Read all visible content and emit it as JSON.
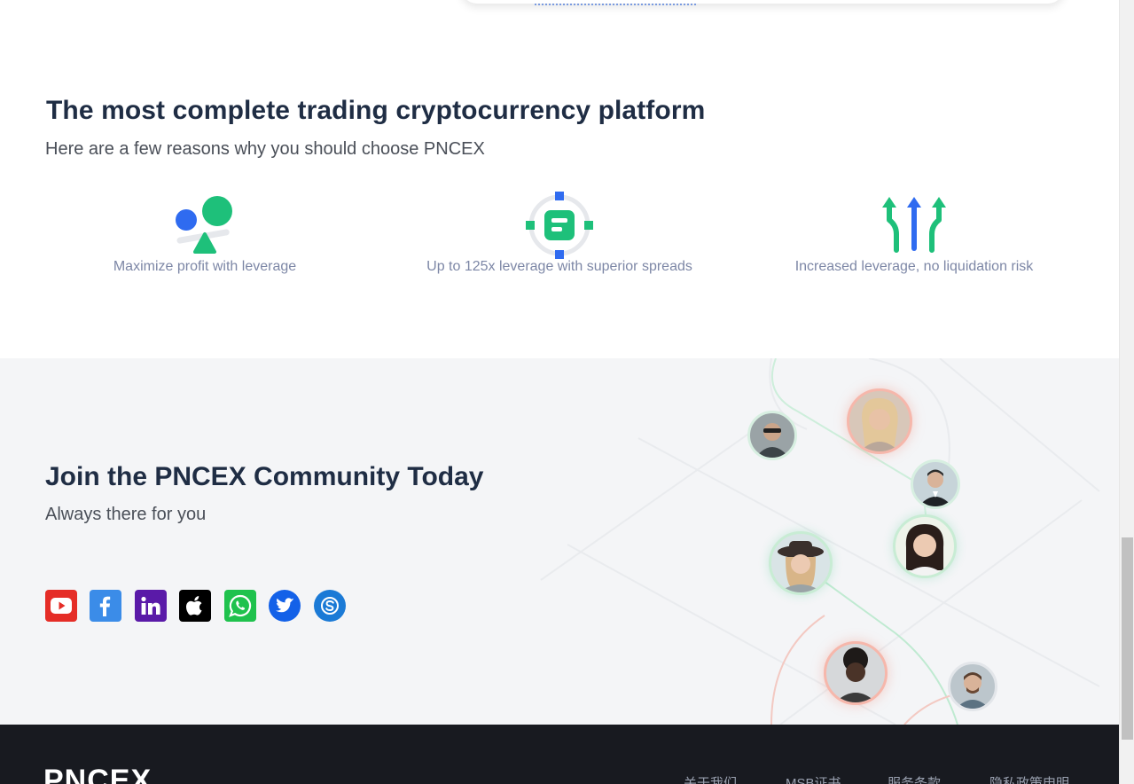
{
  "features": {
    "title": "The most complete trading cryptocurrency platform",
    "subtitle": "Here are a few reasons why you should choose PNCEX",
    "items": [
      {
        "label": "Maximize profit with leverage",
        "icon": "leverage-balance-icon"
      },
      {
        "label": "Up to 125x leverage with superior spreads",
        "icon": "target-spread-icon"
      },
      {
        "label": "Increased leverage, no liquidation risk",
        "icon": "rising-arrows-icon"
      }
    ]
  },
  "community": {
    "title": "Join the PNCEX Community Today",
    "subtitle": "Always there for you",
    "socials": [
      {
        "name": "youtube",
        "color": "#e52d27"
      },
      {
        "name": "facebook",
        "color": "#3b8ce8"
      },
      {
        "name": "linkedin",
        "color": "#5a1aa8"
      },
      {
        "name": "apple",
        "color": "#000000"
      },
      {
        "name": "whatsapp",
        "color": "#1fc24d"
      },
      {
        "name": "twitter",
        "color": "#1361e8"
      },
      {
        "name": "skype",
        "color": "#1b7ad6"
      }
    ]
  },
  "footer": {
    "logo": "PNCEX",
    "links": [
      "关于我们",
      "MSB证书",
      "服务条款",
      "隐私政策申明"
    ]
  },
  "colors": {
    "heading": "#1f2d44",
    "green": "#1ec07a",
    "blue": "#2f6bf0",
    "muted": "#7d87a6",
    "footer_bg": "#181a20"
  }
}
